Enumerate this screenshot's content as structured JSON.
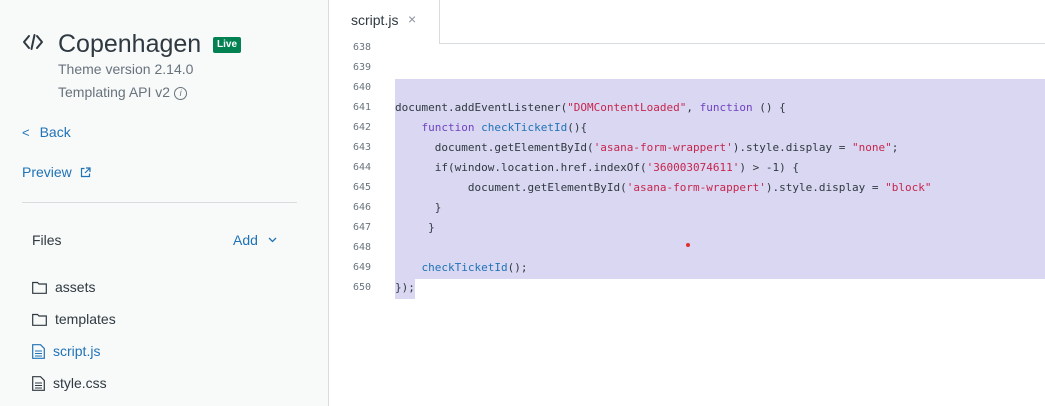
{
  "sidebar": {
    "theme_name": "Copenhagen",
    "live_badge": "Live",
    "theme_version": "Theme version 2.14.0",
    "templating_api": "Templating API v2",
    "back_label": "Back",
    "preview_label": "Preview",
    "files_label": "Files",
    "add_label": "Add",
    "files": [
      {
        "name": "assets",
        "icon": "folder-icon"
      },
      {
        "name": "templates",
        "icon": "folder-icon"
      },
      {
        "name": "script.js",
        "icon": "file-icon",
        "active": true
      },
      {
        "name": "style.css",
        "icon": "file-icon"
      }
    ]
  },
  "editor": {
    "tab_label": "script.js",
    "tab_close": "×",
    "lines": [
      {
        "num": "638",
        "code": ""
      },
      {
        "num": "639",
        "code": ""
      },
      {
        "num": "640",
        "code": ""
      },
      {
        "num": "641",
        "code": "document.addEventListener(\"DOMContentLoaded\", function () {"
      },
      {
        "num": "642",
        "code": "    function checkTicketId(){"
      },
      {
        "num": "643",
        "code": "      document.getElementById('asana-form-wrappert').style.display = \"none\";"
      },
      {
        "num": "644",
        "code": "      if(window.location.href.indexOf('360003074611') > -1) {"
      },
      {
        "num": "645",
        "code": "           document.getElementById('asana-form-wrappert').style.display = \"block\""
      },
      {
        "num": "646",
        "code": "      }"
      },
      {
        "num": "647",
        "code": "     }"
      },
      {
        "num": "648",
        "code": ""
      },
      {
        "num": "649",
        "code": "    checkTicketId();"
      },
      {
        "num": "650",
        "code": "});"
      }
    ]
  },
  "colors": {
    "accent": "#1f73b7",
    "live": "#038153",
    "selection": "#d9d7f1"
  }
}
